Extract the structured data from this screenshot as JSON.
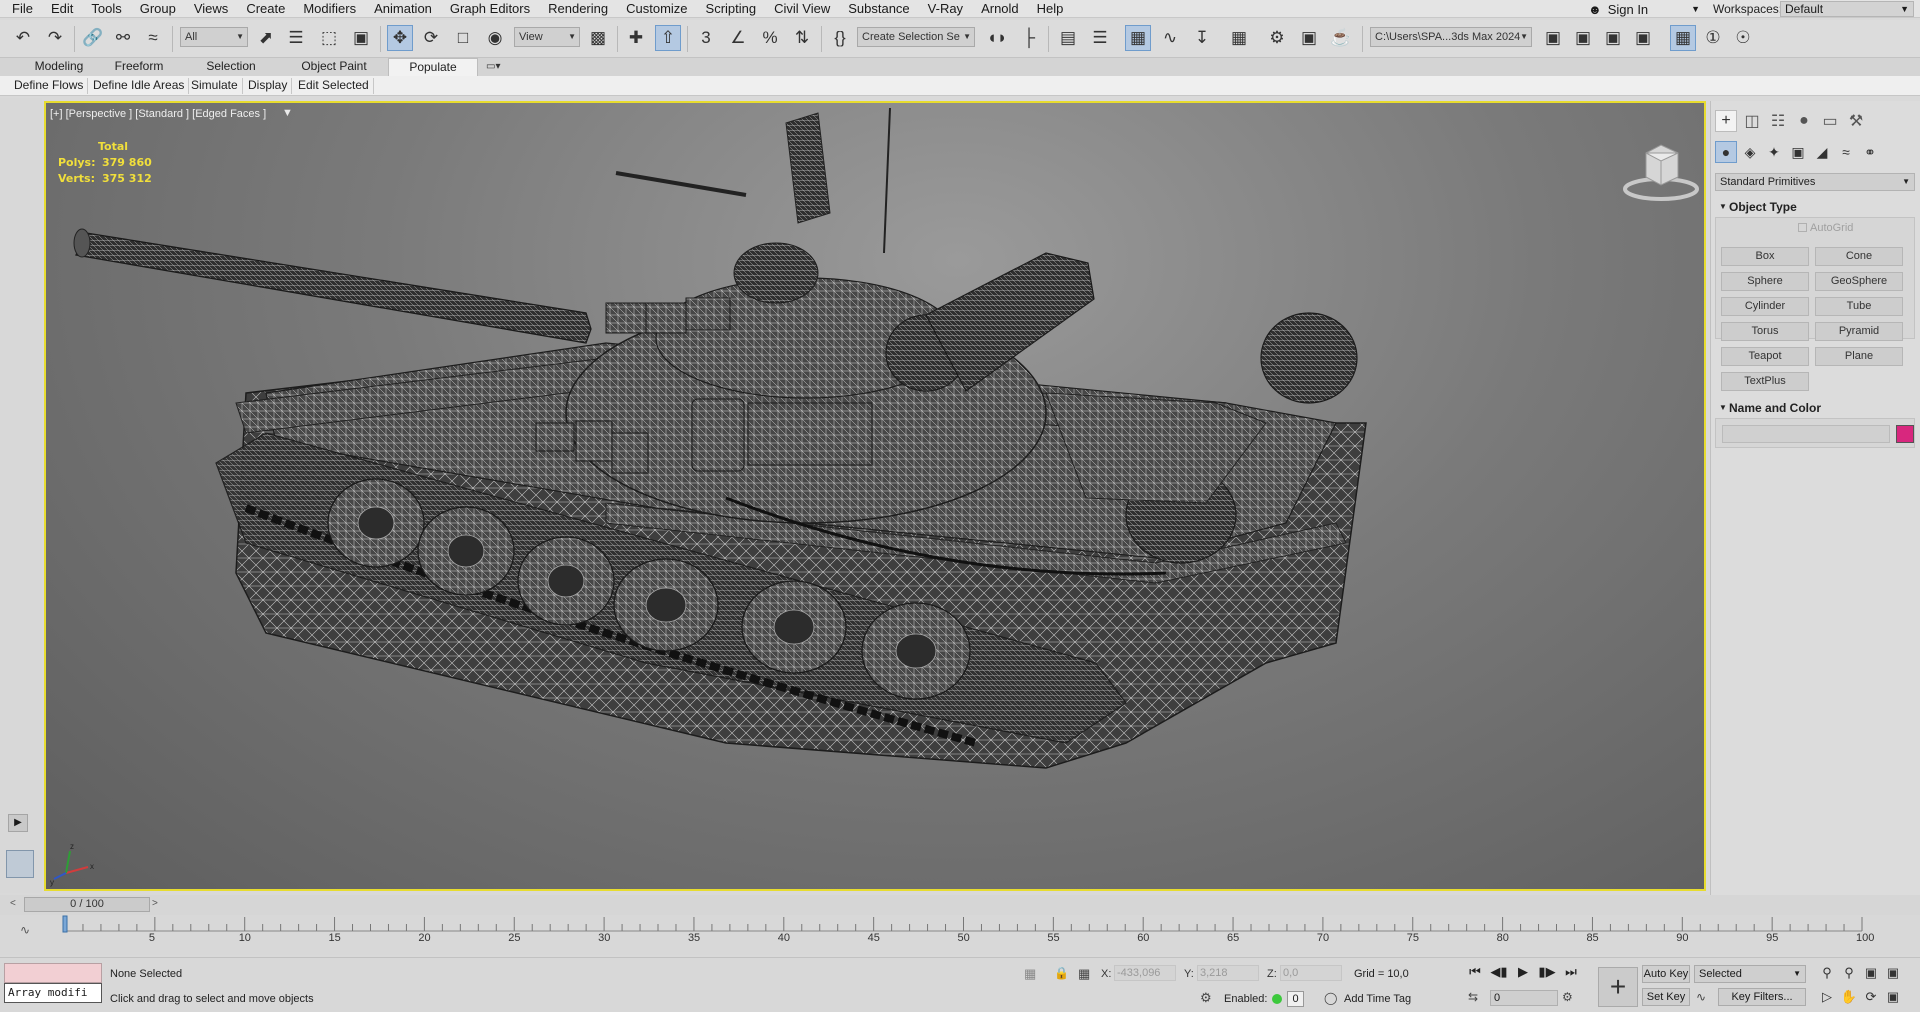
{
  "menubar": {
    "items": [
      "File",
      "Edit",
      "Tools",
      "Group",
      "Views",
      "Create",
      "Modifiers",
      "Animation",
      "Graph Editors",
      "Rendering",
      "Customize",
      "Scripting",
      "Civil View",
      "Substance",
      "V-Ray",
      "Arnold",
      "Help"
    ],
    "signin_label": "Sign In",
    "workspaces_label": "Workspaces:",
    "workspace_value": "Default"
  },
  "toolbar": {
    "selection_filter": "All",
    "ref_coord": "View",
    "named_selection": "Create Selection Se",
    "project_path": "C:\\Users\\SPA...3ds Max 2024",
    "icons": [
      "undo-icon",
      "redo-icon",
      "link-icon",
      "unlink-icon",
      "bind-spacewarp-icon",
      "select-object-icon",
      "select-by-name-icon",
      "rect-selection-icon",
      "window-crossing-icon",
      "select-move-icon",
      "select-rotate-icon",
      "select-scale-icon",
      "select-place-icon",
      "pivot-icon",
      "snap-toggle-icon",
      "angle-snap-icon",
      "percent-snap-icon",
      "spinner-snap-icon",
      "edit-named-sel-icon",
      "mirror-icon",
      "align-icon",
      "scene-explorer-icon",
      "layer-explorer-icon",
      "ribbon-toggle-icon",
      "curve-editor-icon",
      "schematic-view-icon",
      "material-editor-icon",
      "render-setup-icon",
      "rendered-frame-icon",
      "render-icon",
      "render-cloud-icon"
    ]
  },
  "ribbon": {
    "tabs": [
      "Modeling",
      "Freeform",
      "Selection",
      "Object Paint",
      "Populate"
    ],
    "active_tab": "Populate",
    "populate_buttons": [
      "Define Flows",
      "Define Idle Areas",
      "Simulate",
      "Display",
      "Edit Selected"
    ]
  },
  "viewport": {
    "label": "[+] [Perspective ] [Standard ] [Edged Faces ]",
    "stats_title": "Total",
    "polys_label": "Polys:",
    "polys_value": "379 860",
    "verts_label": "Verts:",
    "verts_value": "375 312",
    "border_color": "#e7dc2f",
    "stats_color": "#f1df3b"
  },
  "command_panel": {
    "category": "Standard Primitives",
    "object_type_title": "Object Type",
    "autogrid_label": "AutoGrid",
    "primitives": [
      "Box",
      "Cone",
      "Sphere",
      "GeoSphere",
      "Cylinder",
      "Tube",
      "Torus",
      "Pyramid",
      "Teapot",
      "Plane",
      "TextPlus"
    ],
    "name_color_title": "Name and Color",
    "color_swatch": "#d8277e"
  },
  "timeline": {
    "frame_display": "0 / 100",
    "ticks": [
      5,
      10,
      15,
      20,
      25,
      30,
      35,
      40,
      45,
      50,
      55,
      60,
      65,
      70,
      75,
      80,
      85,
      90,
      95,
      100
    ]
  },
  "statusbar": {
    "maxscript_text": "Array modifi",
    "selection_status": "None Selected",
    "prompt": "Click and drag to select and move objects",
    "x_label": "X:",
    "x_value": "-433,096",
    "y_label": "Y:",
    "y_value": "3,218",
    "z_label": "Z:",
    "z_value": "0,0",
    "grid": "Grid = 10,0",
    "enabled_label": "Enabled:",
    "enabled_count": "0",
    "add_time_tag": "Add Time Tag",
    "current_frame": "0",
    "auto_key": "Auto Key",
    "set_key": "Set Key",
    "key_selection": "Selected",
    "key_filters": "Key Filters..."
  }
}
